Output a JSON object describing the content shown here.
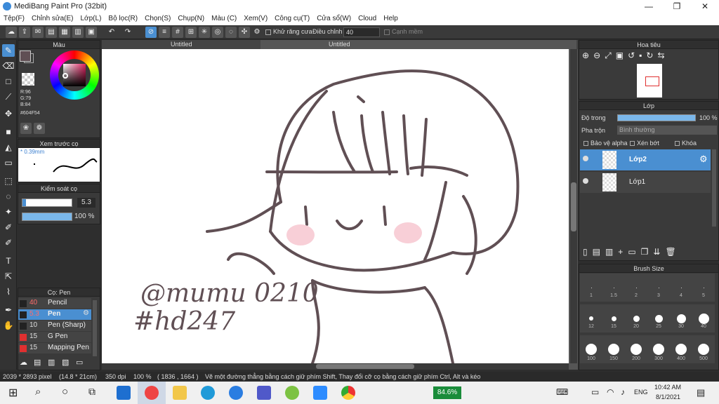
{
  "window": {
    "title": "MediBang Paint Pro (32bit)"
  },
  "menu": [
    "Tệp(F)",
    "Chỉnh sửa(E)",
    "Lớp(L)",
    "Bộ lọc(R)",
    "Chọn(S)",
    "Chụp(N)",
    "Màu (C)",
    "Xem(V)",
    "Công cụ(T)",
    "Cửa sổ(W)",
    "Cloud",
    "Help"
  ],
  "toolbar": {
    "antialias_label": "Khử răng cưa",
    "adjust_label": "Điều chỉnh",
    "adjust_value": "40",
    "edge_label": "Cạnh mềm"
  },
  "color_panel": {
    "title": "Màu",
    "r": "R:96",
    "g": "G:79",
    "b": "B:84",
    "hex": "#604F54",
    "fg_color": "#604F54"
  },
  "brush_preview": {
    "title": "Xem trước cọ",
    "size": "* 0.39mm"
  },
  "brush_control": {
    "title": "Kiểm soát cọ",
    "size_value": "5.3",
    "opacity_value": "100 %"
  },
  "brush_list": {
    "title": "Cọ: Pen",
    "items": [
      {
        "size": "40",
        "name": "Pencil",
        "color": "#222222"
      },
      {
        "size": "5.3",
        "name": "Pen",
        "color": "#222222",
        "selected": true
      },
      {
        "size": "10",
        "name": "Pen (Sharp)",
        "color": "#222222"
      },
      {
        "size": "15",
        "name": "G Pen",
        "color": "#e03030"
      },
      {
        "size": "15",
        "name": "Mapping Pen",
        "color": "#e03030"
      }
    ]
  },
  "tabs": [
    "Untitled",
    "Untitled"
  ],
  "navigator": {
    "title": "Hoa tiêu"
  },
  "layer_panel": {
    "title": "Lớp",
    "opacity_label": "Độ trong",
    "opacity_value": "100 %",
    "blend_label": "Pha trộn",
    "blend_value": "Bình thường",
    "protect_alpha": "Bảo vệ alpha",
    "clipping": "Xén bớt",
    "lock": "Khóa",
    "layers": [
      "Lớp2",
      "Lớp1"
    ]
  },
  "brush_size": {
    "title": "Brush Size",
    "sizes": [
      "1",
      "1.5",
      "2",
      "3",
      "4",
      "5",
      "12",
      "15",
      "20",
      "25",
      "30",
      "40",
      "100",
      "150",
      "200",
      "300",
      "400",
      "500"
    ]
  },
  "status": {
    "dimensions": "2039 * 2893 pixel",
    "physical": "(14.8 * 21cm)",
    "dpi": "350 dpi",
    "zoom": "100 %",
    "coords": "( 1836 , 1664 )",
    "hint": "Vẽ một đường thẳng bằng cách giữ phím Shift, Thay đổi cỡ cọ bằng cách giữ phím Ctrl, Alt và kéo"
  },
  "taskbar": {
    "battery": "84.6%",
    "time": "10:42 AM",
    "date": "8/1/2021",
    "lang": "ENG"
  },
  "drawing": {
    "signature_line1": "@mumu 0210",
    "signature_line2": "#hd247"
  }
}
